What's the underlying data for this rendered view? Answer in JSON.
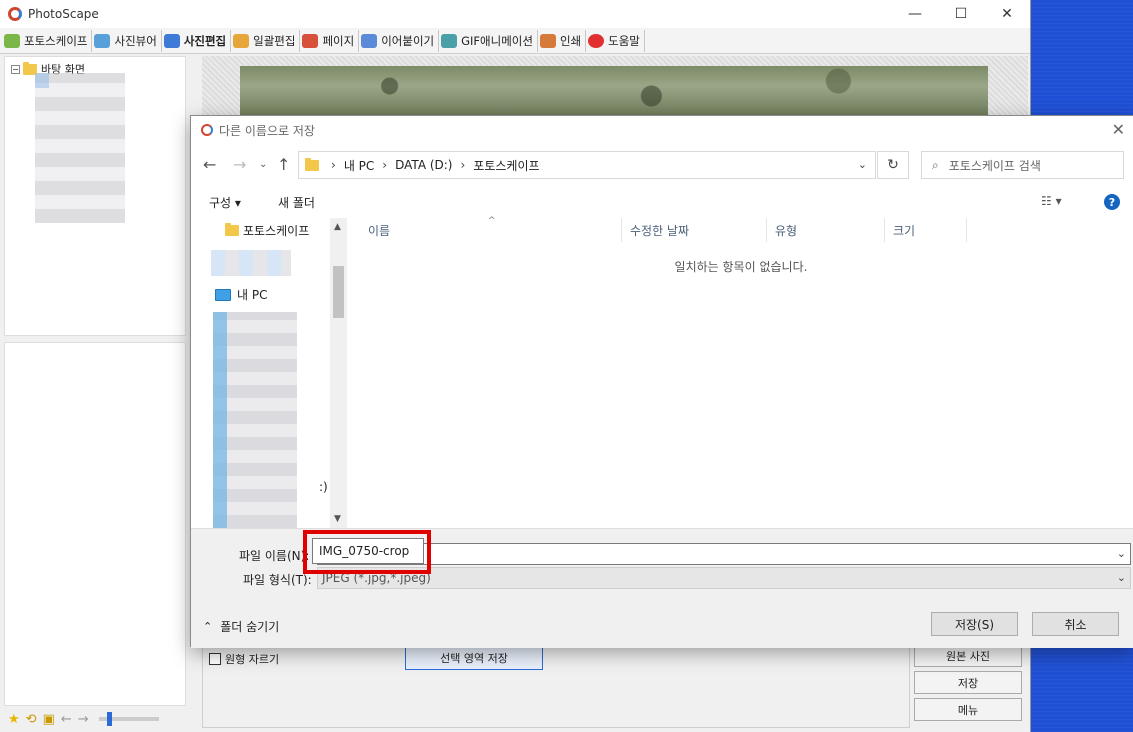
{
  "app": {
    "title": "PhotoScape"
  },
  "window_controls": {
    "minimize": "—",
    "maximize": "☐",
    "close": "✕"
  },
  "tabs": [
    {
      "label": "포토스케이프",
      "color": "#7ab648"
    },
    {
      "label": "사진뷰어",
      "color": "#5aa0d8"
    },
    {
      "label": "사진편집",
      "color": "#3d7bd6"
    },
    {
      "label": "일괄편집",
      "color": "#e6a63a"
    },
    {
      "label": "페이지",
      "color": "#d6503a"
    },
    {
      "label": "이어붙이기",
      "color": "#5a8ad8"
    },
    {
      "label": "GIF애니메이션",
      "color": "#4aa0a8"
    },
    {
      "label": "인쇄",
      "color": "#d67a3a"
    },
    {
      "label": "도움말",
      "color": "#e03030"
    }
  ],
  "left_tree": {
    "root_label": "바탕 화면"
  },
  "crop_panel": {
    "circle_crop_label": "원형 자르기",
    "save_selection_label": "선택 영역 저장"
  },
  "side_buttons": {
    "original": "원본 사진",
    "save": "저장",
    "menu": "메뉴"
  },
  "dialog": {
    "title": "다른 이름으로 저장",
    "path": [
      "내 PC",
      "DATA (D:)",
      "포토스케이프"
    ],
    "search_placeholder": "포토스케이프 검색",
    "organize_label": "구성 ▾",
    "new_folder_label": "새 폴더",
    "nav_items": {
      "folder": "포토스케이프",
      "pc": "내 PC",
      "cut_text": ":)"
    },
    "columns": [
      "이름",
      "수정한 날짜",
      "유형",
      "크기"
    ],
    "empty_message": "일치하는 항목이 없습니다.",
    "filename_label": "파일 이름(N):",
    "filename_value": "IMG_0750-crop",
    "filetype_label": "파일 형식(T):",
    "filetype_value": "JPEG (*.jpg,*.jpeg)",
    "hide_folders_label": "폴더 숨기기",
    "save_button": "저장(S)",
    "cancel_button": "취소"
  },
  "colors": {
    "highlight": "#e00000",
    "accent": "#2b6bd8",
    "desktop": "#1f4fd4"
  }
}
